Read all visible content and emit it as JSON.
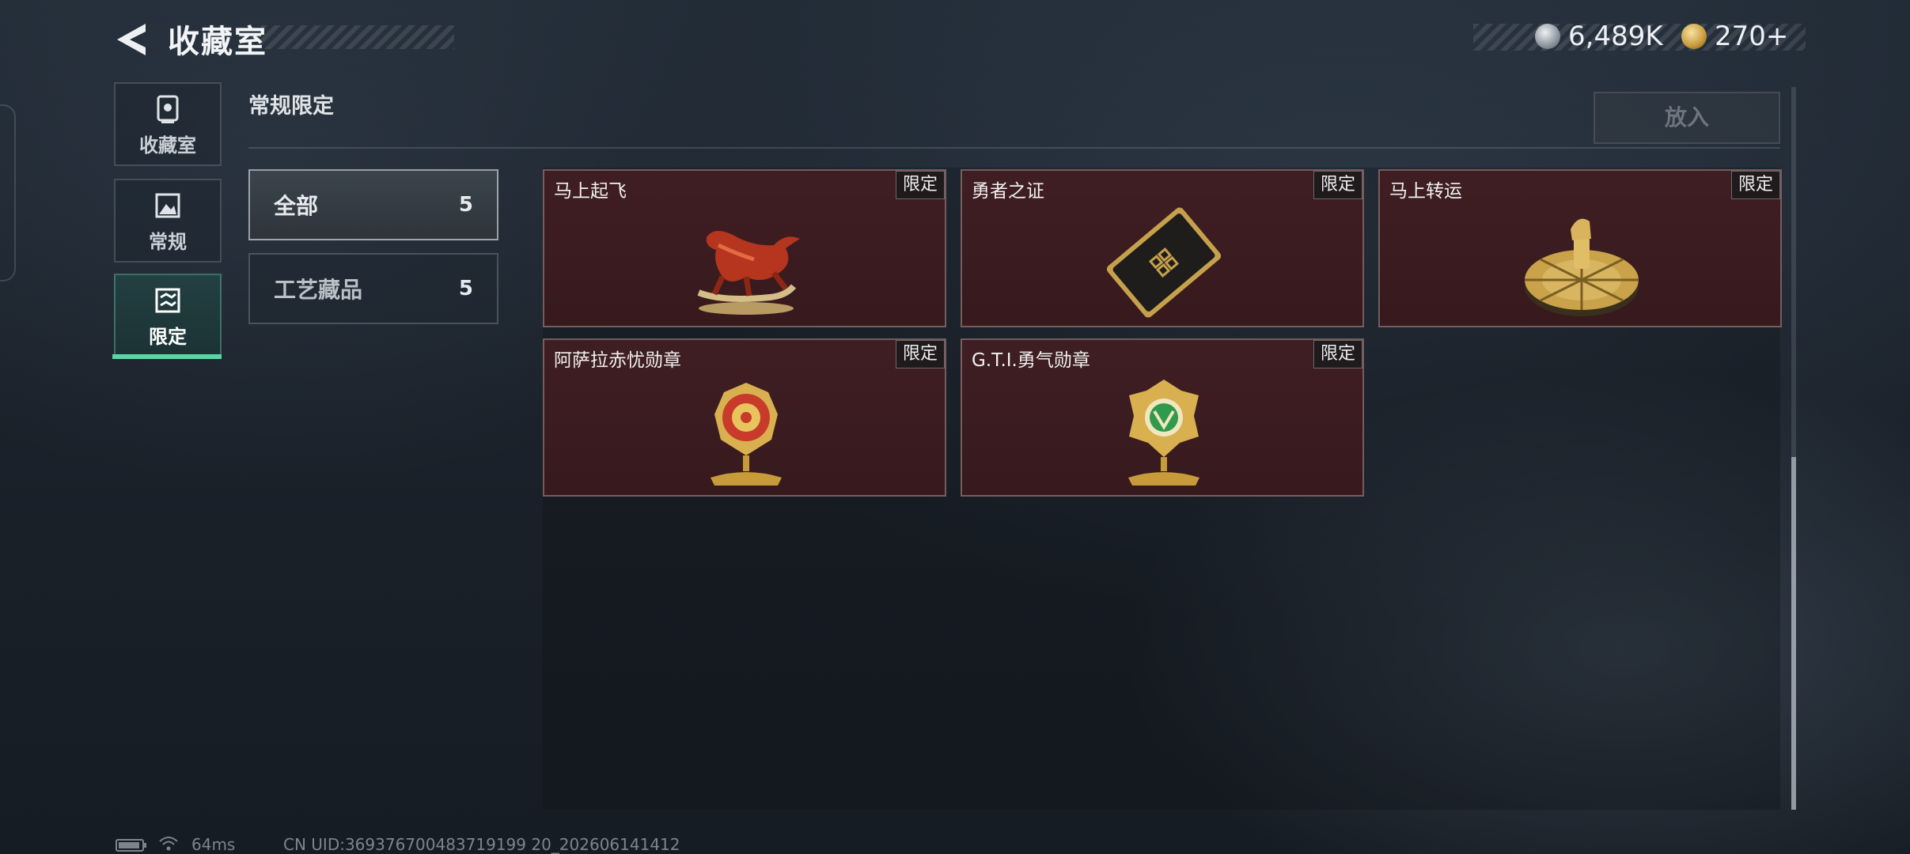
{
  "header": {
    "title": "收藏室",
    "back_icon": "back-arrow-icon",
    "currency": [
      {
        "icon": "silver-coin-icon",
        "amount": "6,489K",
        "color": "#b8bec4"
      },
      {
        "icon": "gold-coin-icon",
        "amount": "270+",
        "color": "#c79a3a"
      }
    ]
  },
  "sidebar": {
    "items": [
      {
        "label": "收藏室",
        "icon": "trophy-icon",
        "active": false
      },
      {
        "label": "常规",
        "icon": "picture-icon",
        "active": false
      },
      {
        "label": "限定",
        "icon": "limited-icon",
        "active": true
      }
    ],
    "active_color": "#58d7a2"
  },
  "section": {
    "title": "常规限定",
    "place_button": "放入"
  },
  "filters": [
    {
      "label": "全部",
      "count": "5",
      "active": true
    },
    {
      "label": "工艺藏品",
      "count": "5",
      "active": false
    }
  ],
  "items": [
    {
      "name": "马上起飞",
      "tag": "限定",
      "art": "red-horse-figure-icon"
    },
    {
      "name": "勇者之证",
      "tag": "限定",
      "art": "brave-card-icon"
    },
    {
      "name": "马上转运",
      "tag": "限定",
      "art": "golden-horse-wheel-icon"
    },
    {
      "name": "阿萨拉赤忧勋章",
      "tag": "限定",
      "art": "red-medal-icon"
    },
    {
      "name": "G.T.I.勇气勋章",
      "tag": "限定",
      "art": "green-medal-icon"
    }
  ],
  "card_bg_color": "#3c1d21",
  "footer": {
    "ping": "64ms",
    "uid": "CN UID:369376700483719199 20_202606141412"
  }
}
